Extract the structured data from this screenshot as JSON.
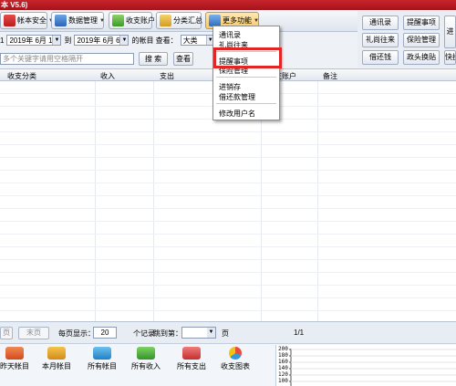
{
  "window": {
    "title": "本 V5.6)"
  },
  "toolbar": {
    "items": [
      {
        "label": "帐本安全",
        "icon": "red-shield-icon"
      },
      {
        "label": "数据管理",
        "icon": "database-icon"
      },
      {
        "label": "收支账户",
        "icon": "money-bag-icon"
      },
      {
        "label": "分类汇总",
        "icon": "summary-icon"
      },
      {
        "label": "更多功能",
        "icon": "more-functions-icon"
      }
    ]
  },
  "filter": {
    "prefix": "1",
    "date_from": "2019年 6月 1日",
    "to_label": "到",
    "date_to": "2019年 6月 6日",
    "account_label": "的帐目 查看：",
    "view_select": "大类"
  },
  "search": {
    "placeholder": "多个关键字请用空格隔开",
    "search_button": "搜 索",
    "view_button": "查看"
  },
  "right_buttons": [
    {
      "label": "通讯录"
    },
    {
      "label": "提醒事项"
    },
    {
      "label": "进"
    },
    {
      "label": "礼尚往来"
    },
    {
      "label": "保险管理"
    },
    {
      "label": "借还钱"
    },
    {
      "label": "政头换贴"
    },
    {
      "label": "快捷"
    }
  ],
  "table": {
    "columns": [
      "收支分类",
      "收入",
      "支出",
      "收支账户",
      "备注"
    ]
  },
  "dropdown_menu": {
    "items": [
      {
        "label": "通讯录"
      },
      {
        "label": "礼尚往来"
      },
      {
        "label": "提醒事项"
      },
      {
        "label": "保险管理"
      },
      {
        "label": "进销存"
      },
      {
        "label": "借还款管理"
      },
      {
        "label": "修改用户名"
      }
    ]
  },
  "pager": {
    "prev_page": "页",
    "last_page": "末页",
    "per_page_label": "每页显示：",
    "per_page_value": "20",
    "records_label": "个记录",
    "jump_label": "跳到第：",
    "page_suffix": "页",
    "page_info": "1/1"
  },
  "shortcuts": [
    {
      "label": "昨天帐目",
      "icon": "yesterday-icon"
    },
    {
      "label": "本月帐目",
      "icon": "month-icon"
    },
    {
      "label": "所有帐目",
      "icon": "all-accounts-icon"
    },
    {
      "label": "所有收入",
      "icon": "income-icon"
    },
    {
      "label": "所有支出",
      "icon": "expense-icon"
    },
    {
      "label": "收支图表",
      "icon": "pie-chart-icon"
    }
  ],
  "mini_chart": {
    "y_ticks": [
      "200",
      "180",
      "160",
      "140",
      "120",
      "100"
    ]
  },
  "colors": {
    "title_bar": "#b71c23",
    "highlight_box": "#e52424",
    "toolbar_active": "#f7c96a"
  }
}
